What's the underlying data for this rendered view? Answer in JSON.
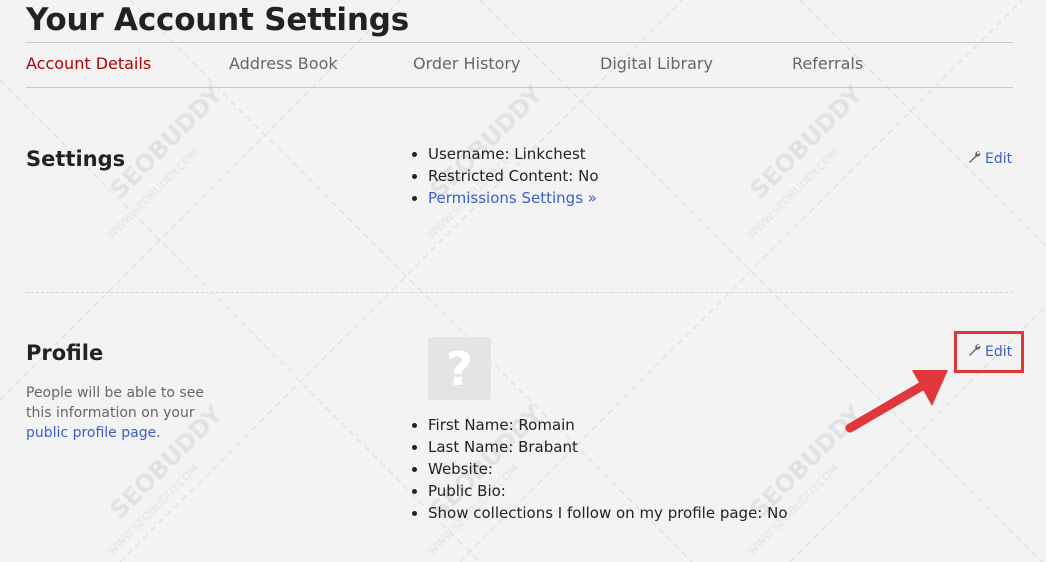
{
  "header": {
    "title": "Your Account Settings"
  },
  "tabs": [
    {
      "label": "Account Details",
      "active": true
    },
    {
      "label": "Address Book",
      "active": false
    },
    {
      "label": "Order History",
      "active": false
    },
    {
      "label": "Digital Library",
      "active": false
    },
    {
      "label": "Referrals",
      "active": false
    }
  ],
  "settings": {
    "title": "Settings",
    "username": "Username: Linkchest",
    "restricted": "Restricted Content: No",
    "permissions_link": "Permissions Settings »",
    "edit_label": "Edit"
  },
  "profile": {
    "title": "Profile",
    "description": "People will be able to see this information on your",
    "description_link": "public profile page",
    "description_end": ".",
    "avatar_placeholder": "?",
    "first_name": "First Name: Romain",
    "last_name": "Last Name: Brabant",
    "website": "Website:",
    "public_bio": "Public Bio:",
    "show_collections": "Show collections I follow on my profile page: No",
    "edit_label": "Edit"
  },
  "watermark": {
    "text": "SEOBUDDY",
    "subtext": "WWW.SEOBUDDY.COM"
  },
  "colors": {
    "active_tab": "#b30000",
    "link": "#3a5fcd",
    "highlight": "#e0383a"
  },
  "icons": {
    "edit": "wrench-icon",
    "annotation": "arrow-icon"
  }
}
